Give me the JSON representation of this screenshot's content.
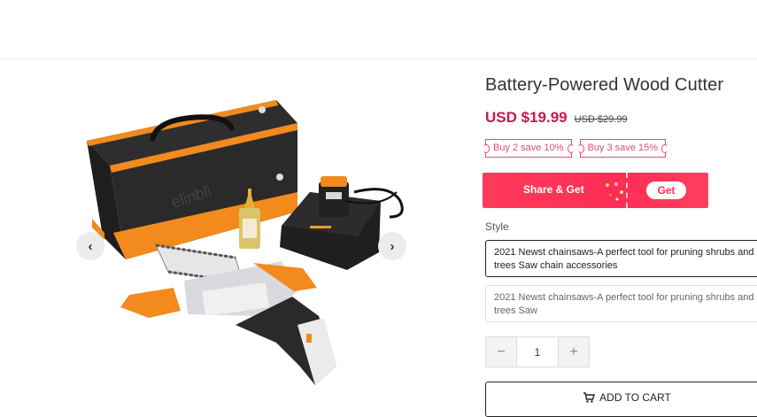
{
  "product": {
    "title": "Battery-Powered Wood Cutter",
    "price": "USD $19.99",
    "original_price": "USD $29.99",
    "watermark": "elinbli"
  },
  "gallery": {
    "prev_icon": "chevron-left-icon",
    "next_icon": "chevron-right-icon"
  },
  "coupons": [
    "Buy 2 save 10%",
    "Buy 3 save 15%"
  ],
  "share": {
    "label": "Share & Get",
    "button": "Get"
  },
  "style": {
    "label": "Style",
    "options": [
      "2021 Newst chainsaws-A perfect tool for pruning shrubs and trees Saw chain accessories",
      "2021 Newst chainsaws-A perfect tool for pruning shrubs and trees Saw"
    ],
    "selected_index": 0
  },
  "quantity": {
    "value": "1",
    "minus": "−",
    "plus": "+"
  },
  "cart": {
    "label": "ADD TO CART",
    "icon": "cart-icon"
  },
  "colors": {
    "price": "#c8194d",
    "accent": "#ff2d55",
    "tool_orange": "#f28a1e"
  }
}
